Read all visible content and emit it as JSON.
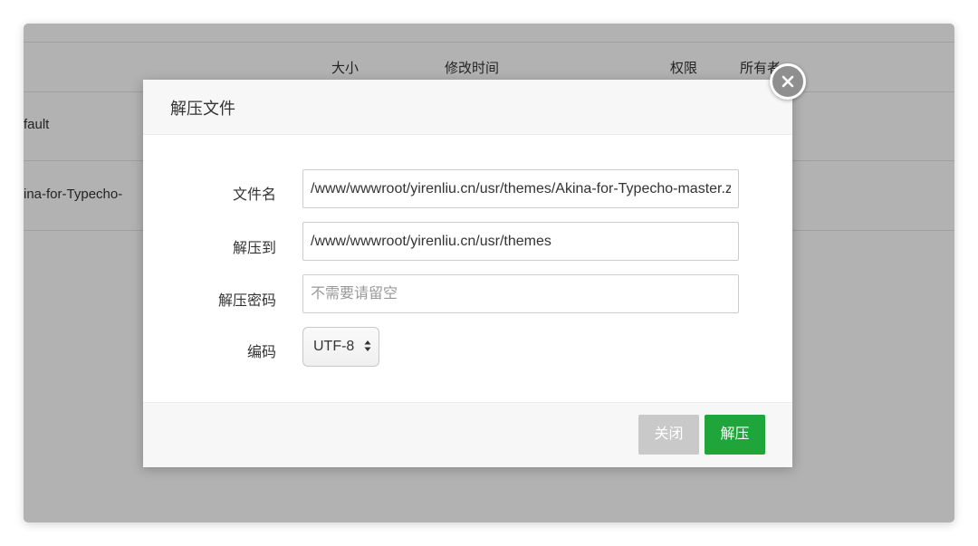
{
  "file_list": {
    "columns": {
      "size": "大小",
      "modified": "修改时间",
      "permission": "权限",
      "owner": "所有者"
    },
    "rows": [
      {
        "name": "fault"
      },
      {
        "name": "ina-for-Typecho-"
      }
    ]
  },
  "dialog": {
    "title": "解压文件",
    "fields": {
      "filename": {
        "label": "文件名",
        "value": "/www/wwwroot/yirenliu.cn/usr/themes/Akina-for-Typecho-master.zip"
      },
      "extract_to": {
        "label": "解压到",
        "value": "/www/wwwroot/yirenliu.cn/usr/themes"
      },
      "password": {
        "label": "解压密码",
        "value": "",
        "placeholder": "不需要请留空"
      },
      "encoding": {
        "label": "编码",
        "selected": "UTF-8"
      }
    },
    "buttons": {
      "close": "关闭",
      "extract": "解压"
    }
  },
  "colors": {
    "primary": "#20a53a",
    "disabled": "#c9c9c9",
    "close_circle": "#8f8f8f"
  },
  "icons": {
    "close": "close-circle-icon",
    "select_arrows": "updown-arrows-icon"
  }
}
